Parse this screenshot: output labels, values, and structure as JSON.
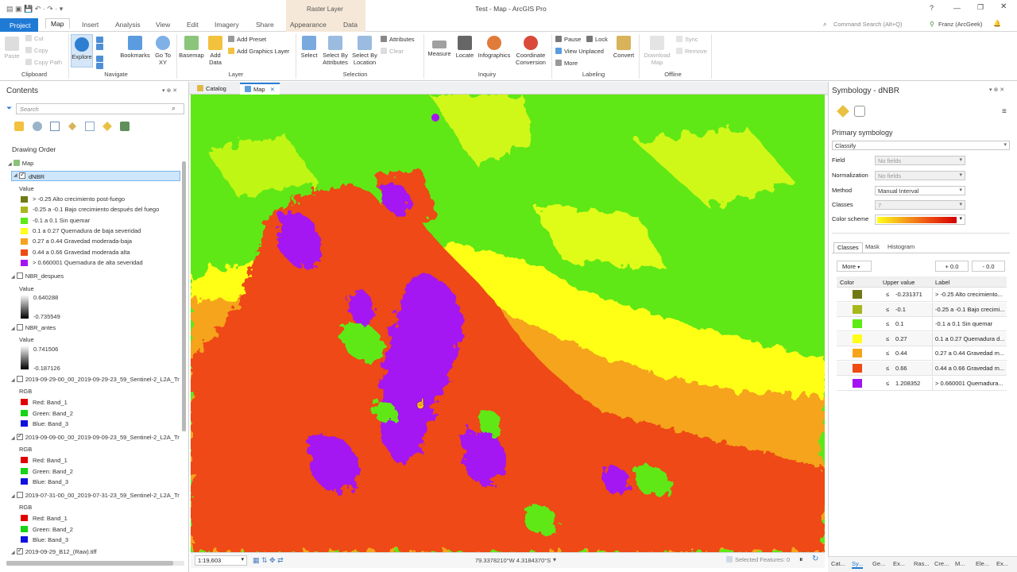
{
  "window": {
    "title": "Test - Map - ArcGIS Pro",
    "contextual_group": "Raster Layer",
    "user": "Franz (ArcGeek)",
    "command_search_placeholder": "Command Search (Alt+Q)",
    "help": "?"
  },
  "ribbon_tabs": [
    "Project",
    "Map",
    "Insert",
    "Analysis",
    "View",
    "Edit",
    "Imagery",
    "Share",
    "Appearance",
    "Data"
  ],
  "ribbon": {
    "clipboard": {
      "paste": "Paste",
      "cut": "Cut",
      "copy": "Copy",
      "copy_path": "Copy Path",
      "group": "Clipboard"
    },
    "navigate": {
      "explore": "Explore",
      "bookmarks": "Bookmarks",
      "go_to_xy": "Go To XY",
      "group": "Navigate"
    },
    "layer": {
      "basemap": "Basemap",
      "add_data": "Add Data",
      "add_preset": "Add Preset",
      "add_graphics": "Add Graphics Layer",
      "group": "Layer"
    },
    "selection": {
      "select": "Select",
      "by_attributes": "Select By Attributes",
      "by_location": "Select By Location",
      "attributes": "Attributes",
      "clear": "Clear",
      "group": "Selection"
    },
    "inquiry": {
      "measure": "Measure",
      "locate": "Locate",
      "infographics": "Infographics",
      "coordinate": "Coordinate Conversion",
      "group": "Inquiry"
    },
    "labeling": {
      "pause": "Pause",
      "lock": "Lock",
      "view_unplaced": "View Unplaced",
      "more": "More",
      "convert": "Convert",
      "group": "Labeling"
    },
    "offline": {
      "download": "Download Map",
      "sync": "Sync",
      "remove": "Remove",
      "group": "Offline"
    }
  },
  "contents": {
    "title": "Contents",
    "search_placeholder": "Search",
    "drawing_order": "Drawing Order",
    "map_name": "Map",
    "dnbr": {
      "name": "dNBR",
      "value_label": "Value",
      "classes": [
        {
          "color": "#6f7a14",
          "label": "> -0.25 Alto crecimiento post-fuego"
        },
        {
          "color": "#a8b81a",
          "label": "-0.25 a -0.1 Bajo crecimiento después del fuego"
        },
        {
          "color": "#5eea16",
          "label": "-0.1 a 0.1 Sin quemar"
        },
        {
          "color": "#ffff18",
          "label": "0.1 a 0.27 Quemadura de baja severidad"
        },
        {
          "color": "#f5a41a",
          "label": "0.27 a 0.44 Gravedad moderada-baja"
        },
        {
          "color": "#ee4a12",
          "label": "0.44 a 0.66 Gravedad moderada alta"
        },
        {
          "color": "#a413f2",
          "label": "> 0.660001 Quemadura de alta severidad"
        }
      ]
    },
    "nbr_despues": {
      "name": "NBR_despues",
      "value_label": "Value",
      "max": "0.640288",
      "min": "-0.735549"
    },
    "nbr_antes": {
      "name": "NBR_antes",
      "value_label": "Value",
      "max": "0.741506",
      "min": "-0.187126"
    },
    "rgb_layers": [
      {
        "name": "2019-09-29-00_00_2019-09-29-23_59_Sentinel-2_L2A_Tr",
        "checked": false
      },
      {
        "name": "2019-09-09-00_00_2019-09-09-23_59_Sentinel-2_L2A_Tr",
        "checked": true
      },
      {
        "name": "2019-07-31-00_00_2019-07-31-23_59_Sentinel-2_L2A_Tr",
        "checked": false
      }
    ],
    "rgb_label": "RGB",
    "bands": [
      "Red:  Band_1",
      "Green: Band_2",
      "Blue:  Band_3"
    ],
    "last_layer": "2019-09-29_B12_(Raw).tiff"
  },
  "map_tabs": {
    "catalog": "Catalog",
    "map": "Map"
  },
  "status": {
    "scale": "1:19,603",
    "coords": "79.3378210°W 4.3184370°S",
    "selected_features": "Selected Features: 0"
  },
  "symbology": {
    "title": "Symbology - dNBR",
    "primary": "Primary symbology",
    "method_value": "Classify",
    "field_label": "Field",
    "field_value": "No fields",
    "normalization_label": "Normalization",
    "normalization_value": "No fields",
    "method_label": "Method",
    "method_sel": "Manual Interval",
    "classes_label": "Classes",
    "classes_value": "7",
    "color_scheme_label": "Color scheme",
    "tabs": [
      "Classes",
      "Mask",
      "Histogram"
    ],
    "more": "More",
    "plus_btn": "+ 0.0",
    "minus_btn": "- 0.0",
    "headers": [
      "Color",
      "Upper value",
      "Label"
    ],
    "rows": [
      {
        "color": "#6f7a14",
        "upper": "-0.231371",
        "label": "> -0.25 Alto crecimiento..."
      },
      {
        "color": "#a8b81a",
        "upper": "-0.1",
        "label": "-0.25 a -0.1 Bajo crecimi..."
      },
      {
        "color": "#5eea16",
        "upper": "0.1",
        "label": "-0.1 a 0.1 Sin quemar"
      },
      {
        "color": "#ffff18",
        "upper": "0.27",
        "label": "0.1 a 0.27 Quemadura d..."
      },
      {
        "color": "#f5a41a",
        "upper": "0.44",
        "label": "0.27 a 0.44 Gravedad m..."
      },
      {
        "color": "#ee4a12",
        "upper": "0.66",
        "label": "0.44 a 0.66 Gravedad m..."
      },
      {
        "color": "#a413f2",
        "upper": "1.208352",
        "label": "> 0.660001 Quemadura..."
      }
    ],
    "le_symbol": "≤"
  },
  "bottom_tabs": [
    "Cat...",
    "Sy...",
    "Ge...",
    "Ex...",
    "Ras...",
    "Cre...",
    "M...",
    "Ele...",
    "Ex..."
  ]
}
